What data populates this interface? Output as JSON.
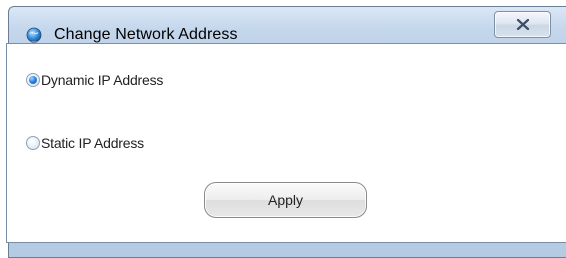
{
  "window": {
    "title": "Change Network Address",
    "icon": "network-globe-icon",
    "close_icon": "close-icon"
  },
  "options": [
    {
      "label": "Dynamic IP Address",
      "checked": true
    },
    {
      "label": "Static IP Address",
      "checked": false
    }
  ],
  "actions": {
    "apply_label": "Apply"
  },
  "colors": {
    "window_frame": "#b8cde6",
    "radio_selected": "#2f86e0",
    "button_face": "#eeeeee"
  }
}
